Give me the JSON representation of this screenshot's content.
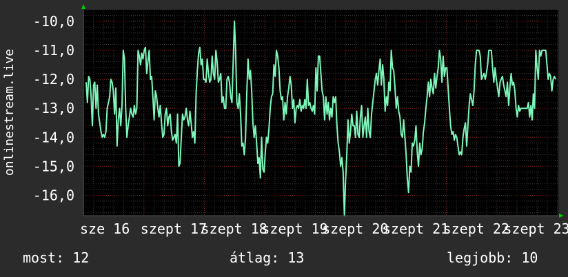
{
  "chart_data": {
    "type": "line",
    "ylabel": "onlinestream.live",
    "ylim": [
      -16.7,
      -9.6
    ],
    "y_ticks": [
      -10.0,
      -11.0,
      -12.0,
      -13.0,
      -14.0,
      -15.0,
      -16.0
    ],
    "y_tick_labels": [
      "-10,0",
      "-11,0",
      "-12,0",
      "-13,0",
      "-14,0",
      "-15,0",
      "-16,0"
    ],
    "x_tick_labels": [
      "sze 16",
      "szept 17",
      "szept 18",
      "szept 19",
      "szept 20",
      "szept 21",
      "szept 22",
      "szept 23"
    ],
    "grid": true,
    "series": [
      {
        "color": "#7ef7bb",
        "values": [
          -12.1,
          -12.8,
          -11.9,
          -12.0,
          -12.6,
          -13.6,
          -12.2,
          -12.1,
          -13.0,
          -12.2,
          -13.2,
          -13.5,
          -13.8,
          -14.0,
          -13.9,
          -14.0,
          -13.8,
          -13.0,
          -12.8,
          -12.6,
          -12.0,
          -12.1,
          -12.4,
          -13.2,
          -12.3,
          -14.3,
          -13.4,
          -13.0,
          -13.6,
          -12.9,
          -11.0,
          -11.3,
          -13.0,
          -14.0,
          -13.6,
          -13.3,
          -13.0,
          -13.2,
          -13.3,
          -12.9,
          -13.2,
          -13.0,
          -11.0,
          -11.2,
          -11.5,
          -11.1,
          -11.3,
          -11.0,
          -10.9,
          -11.8,
          -11.4,
          -11.0,
          -12.0,
          -11.9,
          -12.6,
          -13.4,
          -12.4,
          -12.6,
          -13.0,
          -13.3,
          -12.9,
          -13.5,
          -14.0,
          -13.9,
          -13.2,
          -13.0,
          -13.6,
          -13.3,
          -13.2,
          -13.8,
          -14.1,
          -14.0,
          -13.9,
          -14.2,
          -13.2,
          -15.0,
          -14.9,
          -14.0,
          -13.2,
          -13.4,
          -13.3,
          -13.0,
          -13.4,
          -13.6,
          -13.1,
          -13.5,
          -14.0,
          -13.8,
          -14.2,
          -12.5,
          -11.7,
          -11.1,
          -10.9,
          -11.5,
          -11.3,
          -12.0,
          -12.0,
          -12.1,
          -11.3,
          -11.8,
          -12.1,
          -12.0,
          -11.2,
          -11.8,
          -12.0,
          -11.0,
          -11.4,
          -12.1,
          -12.0,
          -11.8,
          -12.8,
          -12.6,
          -13.0,
          -13.0,
          -12.0,
          -11.9,
          -12.1,
          -12.6,
          -12.8,
          -11.4,
          -10.0,
          -11.0,
          -12.8,
          -13.0,
          -12.5,
          -13.2,
          -14.3,
          -14.2,
          -14.6,
          -14.0,
          -12.5,
          -11.3,
          -12.0,
          -11.7,
          -12.4,
          -13.5,
          -14.0,
          -13.6,
          -14.2,
          -14.9,
          -14.7,
          -15.4,
          -14.0,
          -15.1,
          -15.2,
          -14.5,
          -14.0,
          -14.2,
          -13.7,
          -13.0,
          -12.6,
          -12.5,
          -11.5,
          -11.9,
          -11.0,
          -11.2,
          -11.6,
          -12.4,
          -12.7,
          -12.6,
          -13.4,
          -12.8,
          -13.2,
          -12.6,
          -12.3,
          -11.9,
          -12.2,
          -13.0,
          -12.7,
          -13.5,
          -13.0,
          -12.9,
          -13.0,
          -12.7,
          -13.1,
          -12.9,
          -13.0,
          -12.7,
          -13.0,
          -12.0,
          -12.9,
          -12.8,
          -13.0,
          -13.1,
          -12.9,
          -13.2,
          -11.6,
          -12.4,
          -11.2,
          -11.2,
          -11.8,
          -12.4,
          -12.6,
          -13.4,
          -12.6,
          -13.2,
          -12.8,
          -13.4,
          -13.0,
          -13.3,
          -12.6,
          -12.8,
          -12.6,
          -13.6,
          -14.2,
          -14.5,
          -15.0,
          -14.7,
          -15.2,
          -16.7,
          -15.5,
          -14.6,
          -13.4,
          -14.2,
          -13.8,
          -13.2,
          -13.6,
          -13.6,
          -14.0,
          -13.1,
          -13.9,
          -14.0,
          -13.3,
          -12.9,
          -14.0,
          -13.6,
          -13.3,
          -14.0,
          -13.0,
          -13.8,
          -14.0,
          -13.2,
          -12.8,
          -12.4,
          -12.0,
          -11.8,
          -12.2,
          -11.7,
          -11.3,
          -12.2,
          -11.5,
          -12.0,
          -13.1,
          -12.6,
          -12.9,
          -12.1,
          -12.4,
          -11.0,
          -11.6,
          -11.7,
          -12.3,
          -13.0,
          -12.6,
          -13.1,
          -13.3,
          -13.9,
          -14.0,
          -13.4,
          -14.0,
          -14.6,
          -15.4,
          -15.9,
          -15.0,
          -15.2,
          -14.2,
          -14.3,
          -14.1,
          -13.6,
          -14.5,
          -15.0,
          -14.2,
          -14.6,
          -14.4,
          -13.8,
          -13.5,
          -13.0,
          -12.6,
          -12.1,
          -12.6,
          -12.0,
          -12.3,
          -12.5,
          -11.8,
          -12.3,
          -11.9,
          -11.6,
          -11.0,
          -11.3,
          -12.1,
          -11.2,
          -11.9,
          -11.6,
          -11.6,
          -12.3,
          -13.0,
          -13.6,
          -13.9,
          -13.8,
          -14.1,
          -13.9,
          -14.0,
          -14.3,
          -14.6,
          -14.5,
          -14.6,
          -14.0,
          -13.7,
          -13.5,
          -14.3,
          -13.6,
          -12.9,
          -12.5,
          -12.7,
          -12.9,
          -12.4,
          -11.5,
          -11.0,
          -11.0,
          -11.0,
          -11.2,
          -12.0,
          -11.9,
          -11.8,
          -12.0,
          -11.8,
          -11.5,
          -11.0,
          -11.0,
          -11.0,
          -11.6,
          -12.1,
          -11.6,
          -12.0,
          -12.3,
          -12.6,
          -12.1,
          -12.0,
          -11.9,
          -12.2,
          -12.4,
          -12.6,
          -12.1,
          -12.9,
          -12.3,
          -11.8,
          -12.2,
          -12.1,
          -12.4,
          -13.0,
          -13.3,
          -12.9,
          -13.1,
          -13.0,
          -13.0,
          -13.0,
          -13.0,
          -13.0,
          -13.0,
          -12.8,
          -13.3,
          -12.9,
          -13.4,
          -12.5,
          -13.0,
          -11.0,
          -11.6,
          -12.0,
          -11.0,
          -11.2,
          -11.0,
          -11.0,
          -11.0,
          -11.0,
          -11.5,
          -12.0,
          -11.8,
          -11.9,
          -12.4,
          -12.0,
          -11.9,
          -12.0
        ]
      }
    ]
  },
  "stats": {
    "current": "most: 12",
    "average": "átlag: 13",
    "best": "legjobb: 10"
  }
}
